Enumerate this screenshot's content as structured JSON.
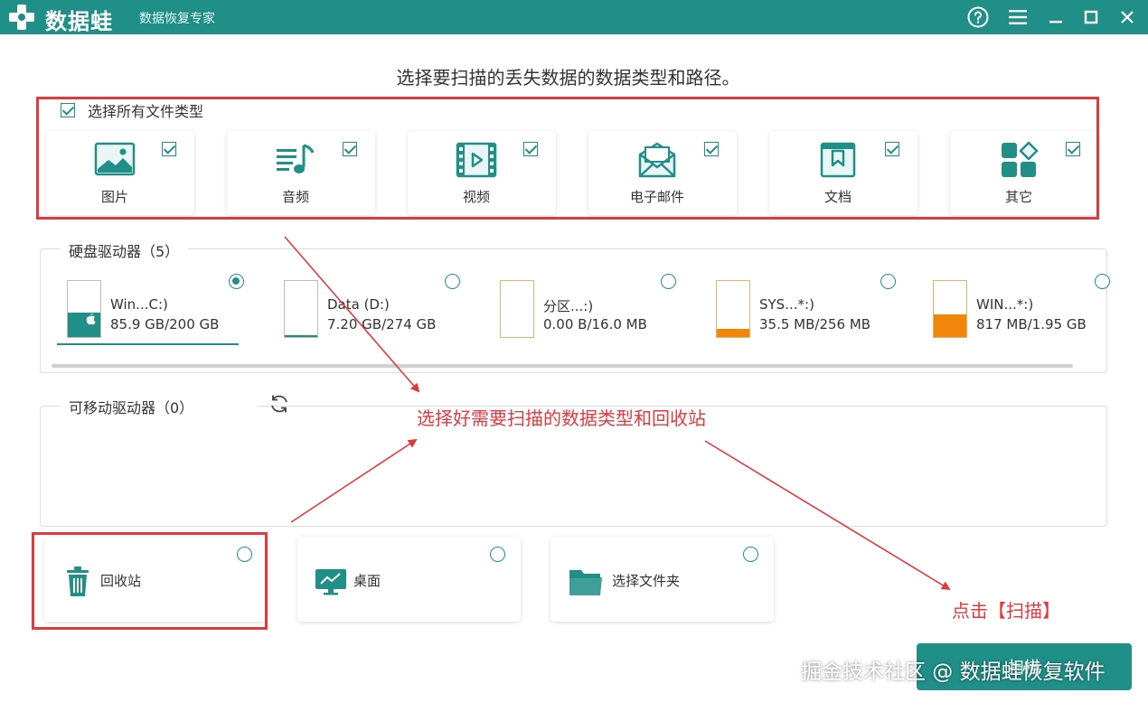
{
  "app": {
    "name": "数据蛙",
    "subtitle": "数据恢复专家"
  },
  "heading": "选择要扫描的丢失数据的数据类型和路径。",
  "file_types": {
    "select_all_label": "选择所有文件类型",
    "select_all_checked": true,
    "items": [
      {
        "label": "图片",
        "icon": "image-icon",
        "checked": true
      },
      {
        "label": "音频",
        "icon": "audio-icon",
        "checked": true
      },
      {
        "label": "视频",
        "icon": "video-icon",
        "checked": true
      },
      {
        "label": "电子邮件",
        "icon": "email-icon",
        "checked": true
      },
      {
        "label": "文档",
        "icon": "document-icon",
        "checked": true
      },
      {
        "label": "其它",
        "icon": "other-icon",
        "checked": true
      }
    ]
  },
  "hard_drives": {
    "title": "硬盘驱动器（5）",
    "items": [
      {
        "name": "Win...C:)",
        "size": "85.9 GB/200 GB",
        "used_fraction": 0.43,
        "fill_color": "#1f8f87",
        "selected": true,
        "icon": "windows-logo-icon"
      },
      {
        "name": "Data (D:)",
        "size": "7.20 GB/274 GB",
        "used_fraction": 0.03,
        "fill_color": "#1f8f87",
        "selected": false
      },
      {
        "name": "分区...:)",
        "size": "0.00  B/16.0 MB",
        "used_fraction": 0.0,
        "fill_color": "#f0860a",
        "selected": false
      },
      {
        "name": "SYS...*:)",
        "size": "35.5 MB/256 MB",
        "used_fraction": 0.14,
        "fill_color": "#f0860a",
        "selected": false
      },
      {
        "name": "WIN...*:)",
        "size": "817 MB/1.95 GB",
        "used_fraction": 0.41,
        "fill_color": "#f0860a",
        "selected": false
      }
    ]
  },
  "removable_drives": {
    "title": "可移动驱动器（0）"
  },
  "locations": [
    {
      "label": "回收站",
      "icon": "recycle-bin-icon",
      "selected": false
    },
    {
      "label": "桌面",
      "icon": "desktop-icon",
      "selected": false
    },
    {
      "label": "选择文件夹",
      "icon": "folder-icon",
      "selected": false
    }
  ],
  "annotations": {
    "center": "选择好需要扫描的数据类型和回收站",
    "scan_hint": "点击【扫描】"
  },
  "scan_button": {
    "label": "扫描"
  },
  "watermark": "掘金技术社区 @ 数据蛙恢复软件",
  "colors": {
    "accent": "#1f8f87",
    "annotation_red": "#e0393e",
    "orange": "#f0860a"
  }
}
